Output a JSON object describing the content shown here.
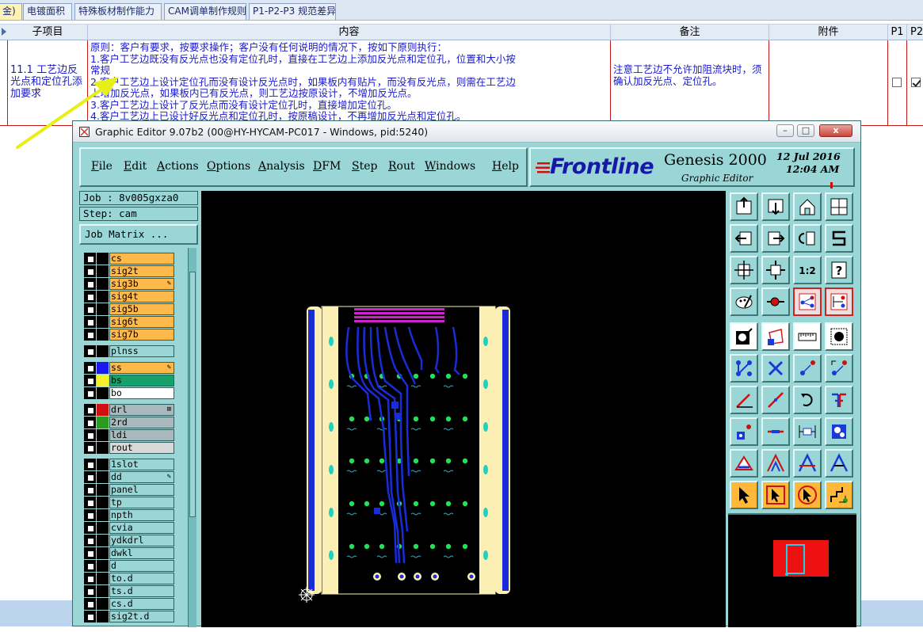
{
  "sheet": {
    "tabs": [
      {
        "label": "金)",
        "active": true
      },
      {
        "label": "电镀面积",
        "active": false
      },
      {
        "label": "特殊板材制作能力",
        "active": false
      },
      {
        "label": "CAM调单制作规则",
        "active": false
      },
      {
        "label": "P1-P2-P3 规范差异",
        "active": false
      }
    ],
    "headers": [
      "子项目",
      "内容",
      "备注",
      "附件",
      "P1",
      "P2"
    ],
    "row": {
      "subitem": "11.1 工艺边反光点和定位孔添加要求",
      "content_lines": [
        "原则：客户有要求，按要求操作；客户没有任何说明的情况下，按如下原则执行：",
        "1.客户工艺边既没有反光点也没有定位孔时，直接在工艺边上添加反光点和定位孔，位置和大小按",
        "常规",
        "2.客户工艺边上设计定位孔而没有设计反光点时，如果板内有贴片，而没有反光点，则需在工艺边",
        "上增加反光点，如果板内已有反光点，则工艺边按原设计，不增加反光点。",
        "3.客户工艺边上设计了反光点而没有设计定位孔时，直接增加定位孔。",
        "4.客户工艺边上已设计好反光点和定位孔时，按原稿设计，不再增加反光点和定位孔。"
      ],
      "remark": "注意工艺边不允许加阻流块时，须确认加反光点、定位孔。",
      "attachment": "",
      "p1_checked": false,
      "p2_checked": true
    }
  },
  "window": {
    "title": "Graphic Editor 9.07b2 (00@HY-HYCAM-PC017 - Windows, pid:5240)",
    "buttons": {
      "minimize": "–",
      "maximize": "□",
      "close": "x"
    }
  },
  "menubar": {
    "items": [
      {
        "label": "File",
        "u": "F",
        "rest": "ile"
      },
      {
        "label": "Edit",
        "u": "E",
        "rest": "dit"
      },
      {
        "label": "Actions",
        "u": "A",
        "rest": "ctions"
      },
      {
        "label": "Options",
        "u": "O",
        "rest": "ptions"
      },
      {
        "label": "Analysis",
        "u": "A",
        "rest": "nalysis"
      },
      {
        "label": "DFM",
        "u": "D",
        "rest": "FM"
      },
      {
        "label": "Step",
        "u": "S",
        "rest": "tep"
      },
      {
        "label": "Rout",
        "u": "R",
        "rest": "out"
      },
      {
        "label": "Windows",
        "u": "W",
        "rest": "indows"
      },
      {
        "label": "Help",
        "u": "H",
        "rest": "elp"
      }
    ]
  },
  "logo": {
    "brand": "Frontline",
    "product": "Genesis 2000",
    "subtitle": "Graphic Editor",
    "date": "12 Jul 2016",
    "time": "12:04 AM"
  },
  "left_panel": {
    "job": "Job : 8v005gxza0",
    "step": "Step: cam",
    "matrix_button": "Job Matrix ..."
  },
  "layers": [
    {
      "name": "cs",
      "swatch": "#000000",
      "bg": "#ffb84a",
      "mark": ""
    },
    {
      "name": "sig2t",
      "swatch": "#000000",
      "bg": "#ffb84a",
      "mark": ""
    },
    {
      "name": "sig3b",
      "swatch": "#000000",
      "bg": "#ffb84a",
      "mark": "✎"
    },
    {
      "name": "sig4t",
      "swatch": "#000000",
      "bg": "#ffb84a",
      "mark": ""
    },
    {
      "name": "sig5b",
      "swatch": "#000000",
      "bg": "#ffb84a",
      "mark": ""
    },
    {
      "name": "sig6t",
      "swatch": "#000000",
      "bg": "#ffb84a",
      "mark": ""
    },
    {
      "name": "sig7b",
      "swatch": "#000000",
      "bg": "#ffb84a",
      "mark": ""
    },
    {
      "name": "plnss",
      "swatch": "#000000",
      "bg": "#9ad6d6",
      "mark": ""
    },
    {
      "name": "ss",
      "swatch": "#1a1aee",
      "bg": "#ffb84a",
      "mark": "✎"
    },
    {
      "name": "bs",
      "swatch": "#f4f02a",
      "bg": "#17a06a",
      "mark": ""
    },
    {
      "name": "bo",
      "swatch": "#000000",
      "bg": "#ffffff",
      "mark": ""
    },
    {
      "name": "drl",
      "swatch": "#d01010",
      "bg": "#a8b8bc",
      "mark": "⊞"
    },
    {
      "name": "2rd",
      "swatch": "#2a9a20",
      "bg": "#a8b8bc",
      "mark": ""
    },
    {
      "name": "ldi",
      "swatch": "#000000",
      "bg": "#a8b8bc",
      "mark": ""
    },
    {
      "name": "rout",
      "swatch": "#000000",
      "bg": "#d8d8d8",
      "mark": ""
    },
    {
      "name": "1slot",
      "swatch": "#000000",
      "bg": "#9ad6d6",
      "mark": ""
    },
    {
      "name": "dd",
      "swatch": "#000000",
      "bg": "#9ad6d6",
      "mark": "✎"
    },
    {
      "name": "panel",
      "swatch": "#000000",
      "bg": "#9ad6d6",
      "mark": ""
    },
    {
      "name": "tp",
      "swatch": "#000000",
      "bg": "#9ad6d6",
      "mark": ""
    },
    {
      "name": "npth",
      "swatch": "#000000",
      "bg": "#9ad6d6",
      "mark": ""
    },
    {
      "name": "cvia",
      "swatch": "#000000",
      "bg": "#9ad6d6",
      "mark": ""
    },
    {
      "name": "ydkdrl",
      "swatch": "#000000",
      "bg": "#9ad6d6",
      "mark": ""
    },
    {
      "name": "dwkl",
      "swatch": "#000000",
      "bg": "#9ad6d6",
      "mark": ""
    },
    {
      "name": "d",
      "swatch": "#000000",
      "bg": "#9ad6d6",
      "mark": ""
    },
    {
      "name": "to.d",
      "swatch": "#000000",
      "bg": "#9ad6d6",
      "mark": ""
    },
    {
      "name": "ts.d",
      "swatch": "#000000",
      "bg": "#9ad6d6",
      "mark": ""
    },
    {
      "name": "cs.d",
      "swatch": "#000000",
      "bg": "#9ad6d6",
      "mark": ""
    },
    {
      "name": "sig2t.d",
      "swatch": "#000000",
      "bg": "#9ad6d6",
      "mark": ""
    }
  ],
  "tools": [
    "zoom-home-icon",
    "zoom-out-icon",
    "home-icon",
    "window-fit-icon",
    "pan-left-icon",
    "pan-right-icon",
    "pan-center-icon",
    "pan-snake-icon",
    "fit-vertical-icon",
    "fit-all-icon",
    "scale-1-2-icon",
    "help-query-icon",
    "palette-icon",
    "snap-icon",
    "display-layers-icon",
    "display-features-icon",
    "pad-icon",
    "select-features-icon",
    "measure-ruler-icon",
    "target-pad-icon",
    "add-line-icon",
    "intersect-icon",
    "move-icon",
    "copy-icon",
    "add-slash-icon",
    "edit-line-icon",
    "rotate-icon",
    "mirror-icon",
    "add-pad-icon",
    "stretch-icon",
    "break-icon",
    "resize-icon",
    "polygon-icon",
    "arc-icon",
    "add-surface-icon",
    "contour-icon",
    "select-pointer-icon",
    "cursor-box-icon",
    "cursor-rotate-icon",
    "route-icon"
  ],
  "colors": {
    "genesis_bg": "#9ad6d6",
    "canvas_bg": "#000000",
    "trace_blue": "#1a2cd8",
    "pad_green": "#22e05a",
    "fiducial_cyan": "#20d0c0",
    "mini_red": "#ee1111"
  }
}
